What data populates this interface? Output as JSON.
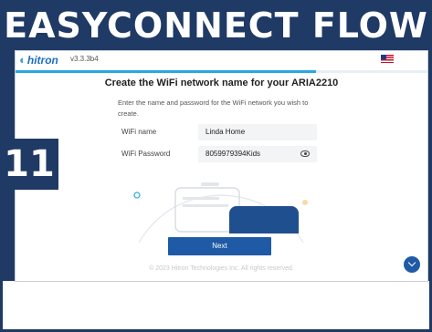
{
  "banner": {
    "title": "EASYCONNECT FLOW"
  },
  "step": {
    "number": "11"
  },
  "app": {
    "logo": "hitron",
    "version": "v3.3.3b4",
    "language_flag": "us-flag-icon",
    "progress": 0.73
  },
  "page": {
    "title": "Create the WiFi network name for your ARIA2210",
    "instructions": "Enter the name and password for the WiFi network you wish to create.",
    "wifi_name_label": "WiFi name",
    "wifi_name_value": "Linda Home",
    "wifi_password_label": "WiFi Password",
    "wifi_password_value": "8059979394Kids",
    "next_label": "Next",
    "footer": "© 2023 Hitron Technologies Inc. All rights reserved."
  },
  "colors": {
    "banner_bg": "#1f3a64",
    "accent": "#29a7e0",
    "button": "#1f5aa6"
  }
}
